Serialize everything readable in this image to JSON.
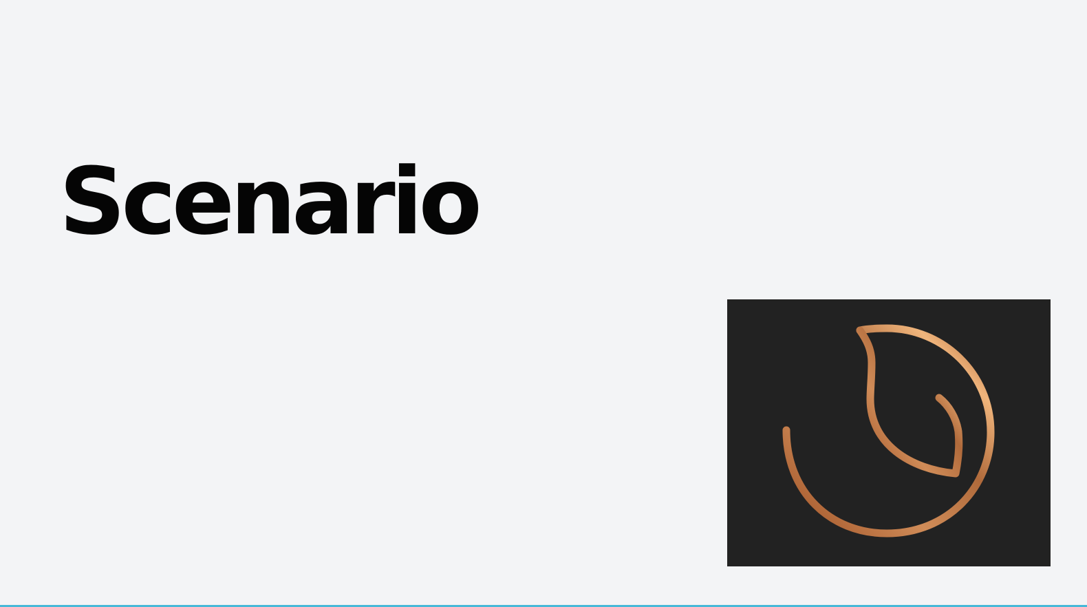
{
  "slide": {
    "title": "Scenario",
    "logo_icon": "leaf-circle-icon"
  },
  "colors": {
    "background": "#f3f4f6",
    "title": "#050505",
    "logo_panel": "#222222",
    "logo_stroke_light": "#e2a970",
    "logo_stroke_dark": "#a45b2f",
    "bottom_rule": "#46b8d8"
  }
}
